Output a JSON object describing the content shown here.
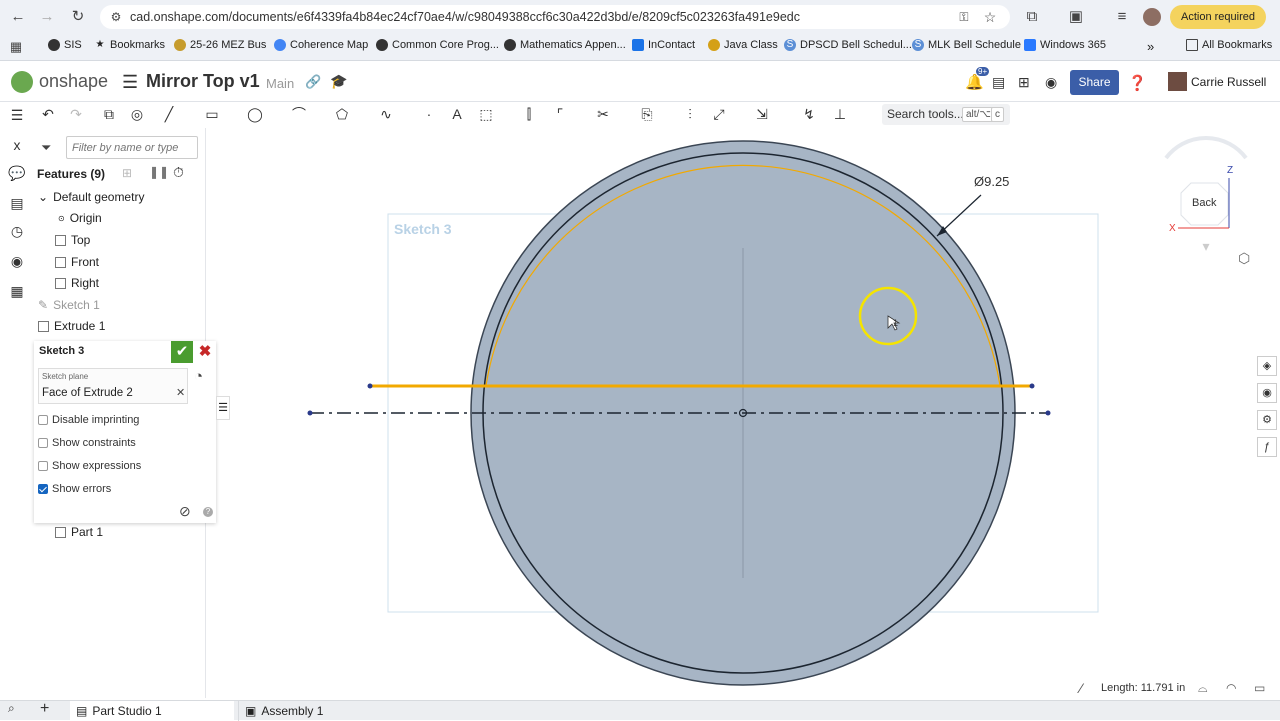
{
  "browser": {
    "url": "cad.onshape.com/documents/e6f4339fa4b84ec24cf70ae4/w/c98049388ccf6c30a422d3bd/e/8209cf5c023263fa491e9edc",
    "action_required": "Action required",
    "bookmarks": [
      "SIS",
      "Bookmarks",
      "25-26 MEZ Bus",
      "Coherence Map",
      "Common Core Prog...",
      "Mathematics Appen...",
      "InContact",
      "Java Class",
      "DPSCD Bell Schedul...",
      "MLK Bell Schedule",
      "Windows 365"
    ],
    "all_bookmarks": "All Bookmarks",
    "more": "»"
  },
  "header": {
    "logo": "onshape",
    "doc_title": "Mirror Top v1",
    "branch": "Main",
    "notifications": "9+",
    "share": "Share",
    "user": "Carrie Russell"
  },
  "toolbar": {
    "search_label": "Search tools...",
    "shortcut_1": "alt/⌥",
    "shortcut_2": "c"
  },
  "features": {
    "filter_placeholder": "Filter by name or type",
    "header": "Features (9)",
    "default_geometry": "Default geometry",
    "items": [
      "Origin",
      "Top",
      "Front",
      "Right",
      "Sketch 1",
      "Extrude 1"
    ],
    "part": "Part 1"
  },
  "sketch_dialog": {
    "title": "Sketch 3",
    "plane_label": "Sketch plane",
    "plane_value": "Face of Extrude 2",
    "options": [
      {
        "label": "Disable imprinting",
        "checked": false
      },
      {
        "label": "Show constraints",
        "checked": false
      },
      {
        "label": "Show expressions",
        "checked": false
      },
      {
        "label": "Show errors",
        "checked": true
      }
    ]
  },
  "viewport": {
    "sketch_label": "Sketch 3",
    "dimension": "Ø9.25",
    "cube_face": "Back",
    "axis_x": "X",
    "axis_z": "Z",
    "cursor_badge": "1",
    "length_readout": "Length: 11.791 in",
    "colors": {
      "disk": "#a7b5c5",
      "selection": "#f2a900",
      "frame": "#cfe0ec"
    }
  },
  "tabs": [
    "Part Studio 1",
    "Assembly 1"
  ]
}
